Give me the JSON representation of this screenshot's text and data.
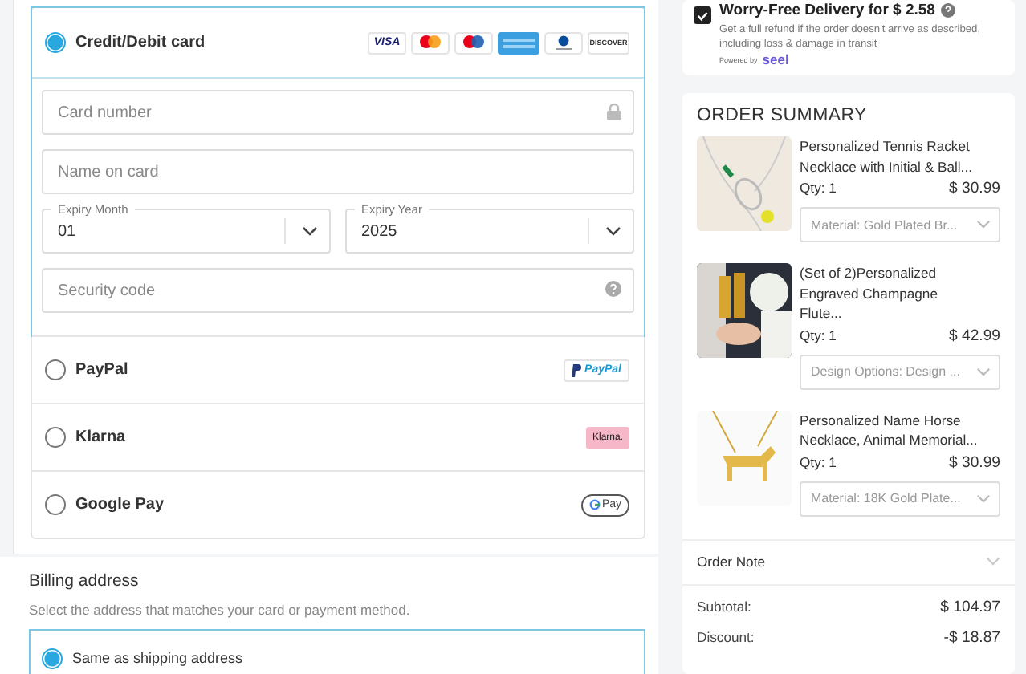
{
  "payment_methods": [
    {
      "kind": "card",
      "label": "Credit/Debit card",
      "selected": true
    },
    {
      "kind": "paypal",
      "label": "PayPal",
      "selected": false,
      "logo": "PayPal"
    },
    {
      "kind": "klarna",
      "label": "Klarna",
      "selected": false,
      "logo": "Klarna."
    },
    {
      "kind": "googlepay",
      "label": "Google Pay",
      "selected": false,
      "logo": "Pay"
    }
  ],
  "card_logos": [
    {
      "kind": "visa",
      "text": "VISA"
    },
    {
      "kind": "mastercard"
    },
    {
      "kind": "maestro"
    },
    {
      "kind": "amex"
    },
    {
      "kind": "diners"
    },
    {
      "kind": "discover",
      "text": "DISCOVER"
    }
  ],
  "card_form": {
    "card_number": {
      "placeholder": "Card number"
    },
    "name_on_card": {
      "placeholder": "Name on card"
    },
    "expiry_month": {
      "label": "Expiry Month",
      "value": "01"
    },
    "expiry_year": {
      "label": "Expiry Year",
      "value": "2025"
    },
    "security_code": {
      "placeholder": "Security code"
    }
  },
  "billing": {
    "title": "Billing address",
    "hint": "Select the address that matches your card or payment method.",
    "options": [
      {
        "label": "Same as shipping address",
        "selected": true
      }
    ]
  },
  "delivery": {
    "checked": true,
    "title": "Worry-Free Delivery for $ 2.58",
    "text": "Get a full refund if the order doesn't arrive as described, including loss & damage in transit",
    "powered_by": "Powered by",
    "brand": "seel"
  },
  "order_summary": {
    "title": "ORDER SUMMARY",
    "items": [
      {
        "kind": "necklace",
        "name": "Personalized Tennis Racket Necklace with Initial & Ball...",
        "qty": "Qty: 1",
        "price": "$ 30.99",
        "option": "Material: Gold Plated Br..."
      },
      {
        "kind": "glasses",
        "name": "(Set of 2)Personalized Engraved Champagne Flute...",
        "qty": "Qty: 1",
        "price": "$ 42.99",
        "option": "Design Options: Design ..."
      },
      {
        "kind": "horse",
        "name": "Personalized Name Horse Necklace, Animal Memorial...",
        "qty": "Qty: 1",
        "price": "$ 30.99",
        "option": "Material: 18K Gold Plate..."
      }
    ],
    "note": "Order Note",
    "totals": [
      {
        "label": "Subtotal:",
        "value": "$ 104.97"
      },
      {
        "label": "Discount:",
        "value": "-$ 18.87"
      }
    ]
  }
}
